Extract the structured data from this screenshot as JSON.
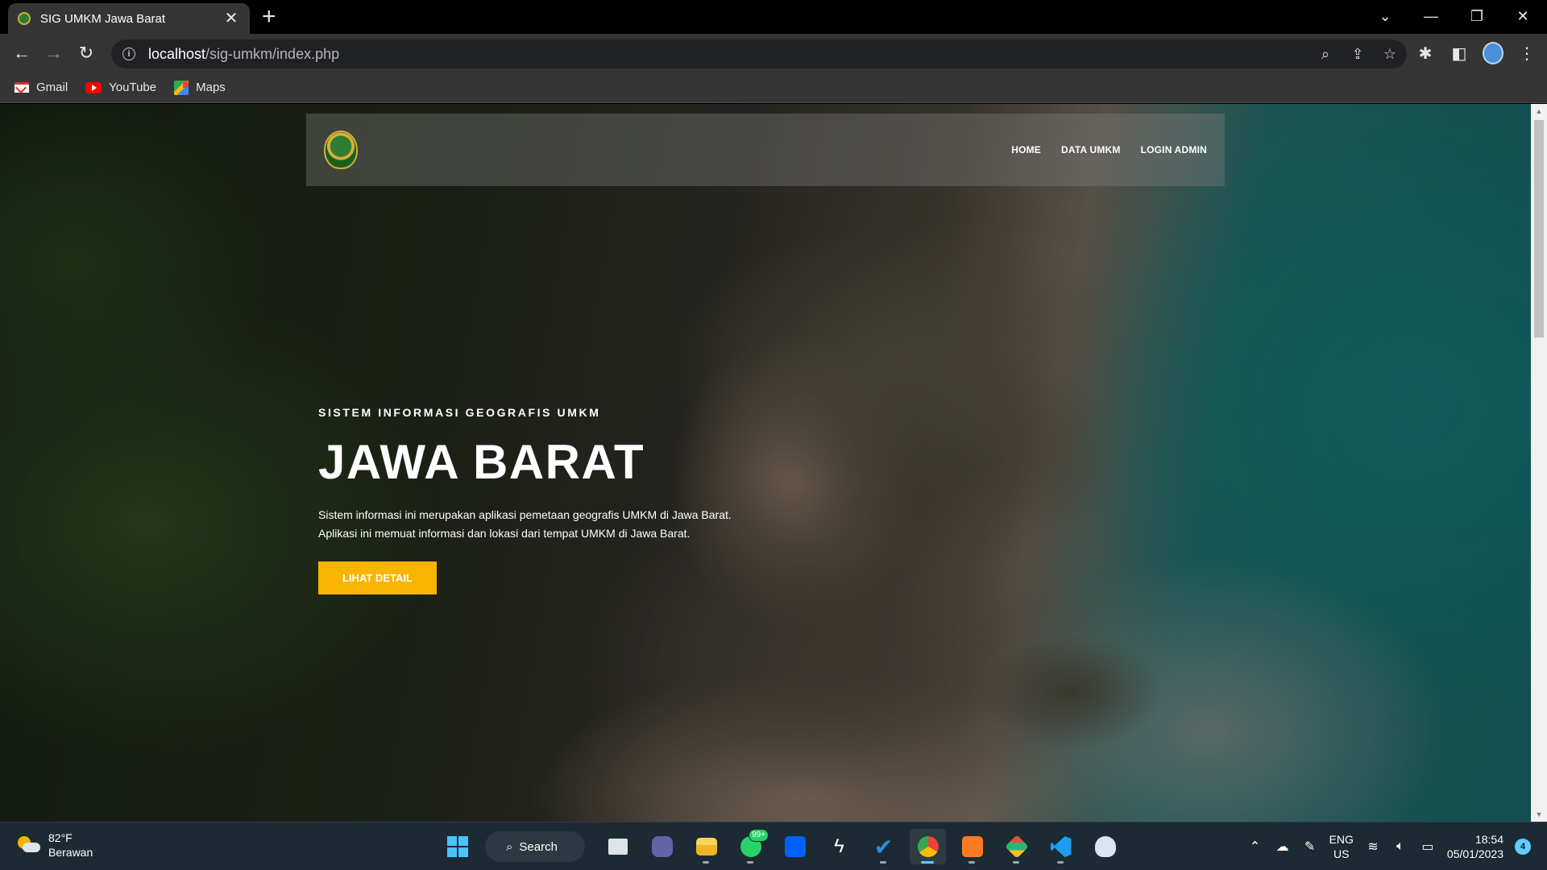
{
  "browser": {
    "tab": {
      "title": "SIG UMKM Jawa Barat",
      "favicon": "jabar-logo-icon"
    },
    "url": {
      "host": "localhost",
      "path": "/sig-umkm/index.php"
    },
    "bookmarks": [
      {
        "label": "Gmail",
        "icon": "gmail-icon"
      },
      {
        "label": "YouTube",
        "icon": "youtube-icon"
      },
      {
        "label": "Maps",
        "icon": "maps-icon"
      }
    ]
  },
  "site": {
    "nav": {
      "logo": "jabar-logo-icon",
      "items": [
        {
          "label": "HOME"
        },
        {
          "label": "DATA UMKM"
        },
        {
          "label": "LOGIN ADMIN"
        }
      ]
    },
    "hero": {
      "kicker": "SISTEM INFORMASI GEOGRAFIS UMKM",
      "title": "JAWA BARAT",
      "description": "Sistem informasi ini merupakan aplikasi pemetaan geografis UMKM di Jawa Barat. Aplikasi ini memuat informasi dan lokasi dari tempat UMKM di Jawa Barat.",
      "button": "LIHAT DETAIL",
      "button_color": "#f7b500"
    }
  },
  "taskbar": {
    "weather": {
      "temp": "82°F",
      "condition": "Berawan"
    },
    "search_label": "Search",
    "whatsapp_badge": "99+",
    "language": {
      "line1": "ENG",
      "line2": "US"
    },
    "clock": {
      "time": "18:54",
      "date": "05/01/2023"
    },
    "notifications": "4"
  },
  "colors": {
    "accent": "#f7b500",
    "taskbar_accent": "#60cdff"
  }
}
